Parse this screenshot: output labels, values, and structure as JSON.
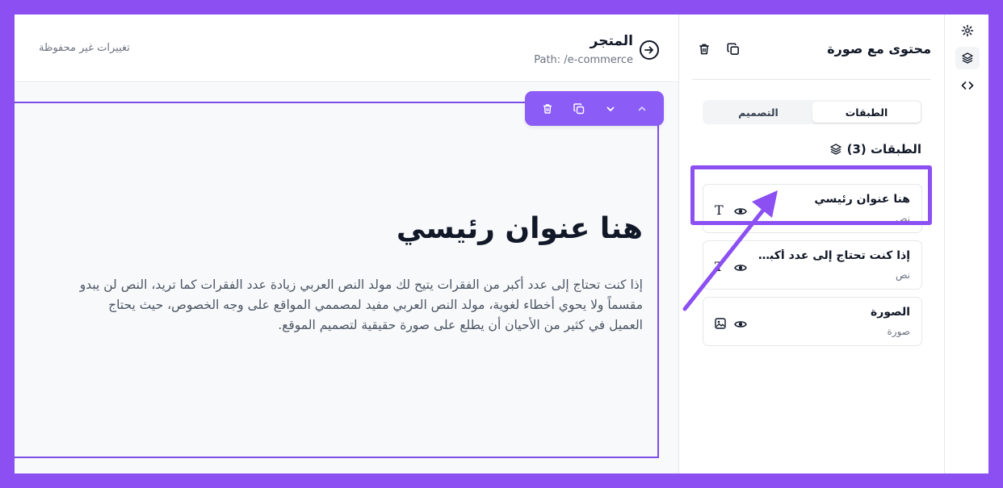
{
  "topbar": {
    "unsaved_label": "تغييرات غير محفوظة",
    "store_title": "المتجر",
    "store_path": "Path: /e-commerce",
    "back_icon": "arrow-circle-right-icon"
  },
  "canvas": {
    "toolbar_icons": [
      "trash-icon",
      "copy-icon",
      "chevron-down-icon",
      "chevron-up-icon"
    ],
    "heading": "هنا عنوان رئيسي",
    "paragraph": "إذا كنت تحتاج إلى عدد أكبر من الفقرات يتيح لك مولد النص العربي زيادة عدد الفقرات كما تريد، النص لن يبدو مقسماً ولا يحوي أخطاء لغوية، مولد النص العربي مفيد لمصممي المواقع على وجه الخصوص، حيث يحتاج العميل في كثير من الأحيان أن يطلع على صورة حقيقية لتصميم الموقع."
  },
  "panel": {
    "title": "محتوى مع صورة",
    "tabs": [
      {
        "label": "الطبقات",
        "active": true
      },
      {
        "label": "التصميم",
        "active": false
      }
    ],
    "layers_header": "الطبقات (3)",
    "layers": [
      {
        "name": "هنا عنوان رئيسي",
        "type": "نص",
        "type_icon": "T",
        "highlighted": true
      },
      {
        "name": "إذا كنت تحتاج إلى عدد أكبر من الفقرات",
        "type": "نص",
        "type_icon": "T",
        "highlighted": false
      },
      {
        "name": "الصورة",
        "type": "صورة",
        "type_icon": "image-icon",
        "highlighted": false
      }
    ]
  },
  "rail": {
    "icons": [
      "gear-icon",
      "layers-icon",
      "code-icon"
    ],
    "active": "layers-icon"
  },
  "colors": {
    "accent": "#8b5cf6",
    "frame_background": "#8b4ff2",
    "selection_outline": "#7c4ee4"
  }
}
